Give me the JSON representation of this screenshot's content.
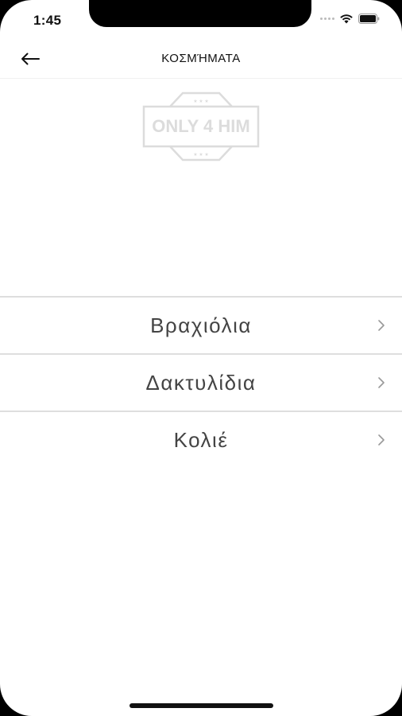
{
  "status_bar": {
    "time": "1:45"
  },
  "nav": {
    "title": "ΚΟΣΜΉΜΑΤΑ",
    "back_icon": "arrow-left-icon"
  },
  "logo": {
    "text": "ONLY 4 HIM",
    "stars_top": "★ ★ ★",
    "stars_bottom": "★ ★ ★"
  },
  "menu": {
    "items": [
      {
        "label": "Βραχιόλια",
        "icon": "chevron-right-icon"
      },
      {
        "label": "Δακτυλίδια",
        "icon": "chevron-right-icon"
      },
      {
        "label": "Κολιέ",
        "icon": "chevron-right-icon"
      }
    ]
  },
  "colors": {
    "background": "#ffffff",
    "text": "#444444",
    "divider": "#dedede",
    "logo": "#dcdcdc"
  }
}
